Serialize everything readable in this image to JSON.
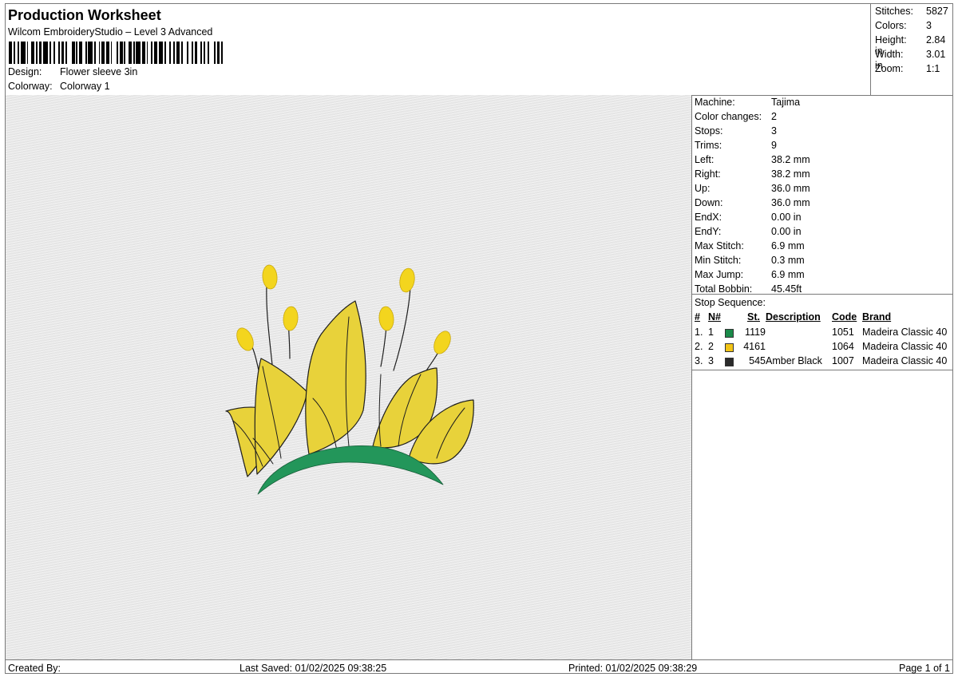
{
  "header": {
    "title": "Production Worksheet",
    "subtitle": "Wilcom EmbroideryStudio – Level 3 Advanced",
    "design_label": "Design:",
    "design_value": "Flower sleeve 3in",
    "colorway_label": "Colorway:",
    "colorway_value": "Colorway 1"
  },
  "stats": {
    "stitches_label": "Stitches:",
    "stitches_value": "5827",
    "colors_label": "Colors:",
    "colors_value": "3",
    "height_label": "Height:",
    "height_value": "2.84 in",
    "width_label": "Width:",
    "width_value": "3.01 in",
    "zoom_label": "Zoom:",
    "zoom_value": "1:1"
  },
  "machine_info": [
    {
      "label": "Machine:",
      "value": "Tajima"
    },
    {
      "label": "Color changes:",
      "value": "2"
    },
    {
      "label": "Stops:",
      "value": "3"
    },
    {
      "label": "Trims:",
      "value": "9"
    },
    {
      "label": "Left:",
      "value": "38.2 mm"
    },
    {
      "label": "Right:",
      "value": "38.2 mm"
    },
    {
      "label": "Up:",
      "value": "36.0 mm"
    },
    {
      "label": "Down:",
      "value": "36.0 mm"
    },
    {
      "label": "EndX:",
      "value": "0.00 in"
    },
    {
      "label": "EndY:",
      "value": "0.00 in"
    },
    {
      "label": "Max Stitch:",
      "value": "6.9 mm"
    },
    {
      "label": "Min Stitch:",
      "value": "0.3 mm"
    },
    {
      "label": "Max Jump:",
      "value": "6.9 mm"
    },
    {
      "label": "Total Bobbin:",
      "value": "45.45ft"
    }
  ],
  "stop_sequence": {
    "title": "Stop Sequence:",
    "headers": {
      "num": "#",
      "n": "N#",
      "st": "St.",
      "description": "Description",
      "code": "Code",
      "brand": "Brand"
    },
    "rows": [
      {
        "num": "1.",
        "n": "1",
        "color": "#1a8a4a",
        "st": "1119",
        "description": "",
        "code": "1051",
        "brand": "Madeira Classic 40"
      },
      {
        "num": "2.",
        "n": "2",
        "color": "#f2c416",
        "st": "4161",
        "description": "",
        "code": "1064",
        "brand": "Madeira Classic 40"
      },
      {
        "num": "3.",
        "n": "3",
        "color": "#2a2a2a",
        "st": "545",
        "description": "Amber Black",
        "code": "1007",
        "brand": "Madeira Classic 40"
      }
    ]
  },
  "footer": {
    "created_by": "Created By:",
    "last_saved": "Last Saved: 01/02/2025 09:38:25",
    "printed": "Printed: 01/02/2025 09:38:29",
    "page": "Page 1 of 1"
  },
  "design_colors": {
    "leaf": "#e8d23a",
    "leaf_shade": "#d8bf22",
    "band": "#23965a",
    "bud": "#f3d51e",
    "outline": "#1e1e1e"
  }
}
